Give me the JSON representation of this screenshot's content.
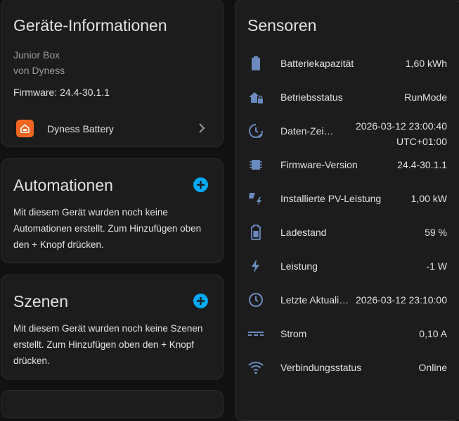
{
  "device": {
    "title": "Geräte-Informationen",
    "model": "Junior Box",
    "manufacturer": "von Dyness",
    "firmware": "Firmware: 24.4-30.1.1",
    "integration_name": "Dyness Battery"
  },
  "automations": {
    "title": "Automationen",
    "text": "Mit diesem Gerät wurden noch keine Automationen erstellt. Zum Hinzufügen oben den + Knopf drücken."
  },
  "scenes": {
    "title": "Szenen",
    "text": "Mit diesem Gerät wurden noch keine Szenen erstellt. Zum Hinzufügen oben den + Knopf drücken."
  },
  "sensors": {
    "title": "Sensoren",
    "items": [
      {
        "label": "Batteriekapazität",
        "value": "1,60 kWh",
        "icon": "battery-icon"
      },
      {
        "label": "Betriebsstatus",
        "value": "RunMode",
        "icon": "home-lock-icon"
      },
      {
        "label": "Daten-Zeitstempel",
        "value_line1": "2026-03-12 23:00:40",
        "value_line2": "UTC+01:00",
        "icon": "clock-check-icon"
      },
      {
        "label": "Firmware-Version",
        "value": "24.4-30.1.1",
        "icon": "chip-icon"
      },
      {
        "label": "Installierte PV-Leistung",
        "value": "1,00 kW",
        "icon": "solar-power-icon"
      },
      {
        "label": "Ladestand",
        "value": "59 %",
        "icon": "battery-60-icon"
      },
      {
        "label": "Leistung",
        "value": "-1 W",
        "icon": "flash-icon"
      },
      {
        "label": "Letzte Aktualisierung",
        "value": "2026-03-12 23:10:00",
        "icon": "clock-icon"
      },
      {
        "label": "Strom",
        "value": "0,10 A",
        "icon": "current-dc-icon"
      },
      {
        "label": "Verbindungsstatus",
        "value": "Online",
        "icon": "wifi-icon"
      }
    ]
  },
  "colors": {
    "accent": "#03a9f4",
    "icon": "#6b8bc0",
    "brand": "#f26522"
  }
}
